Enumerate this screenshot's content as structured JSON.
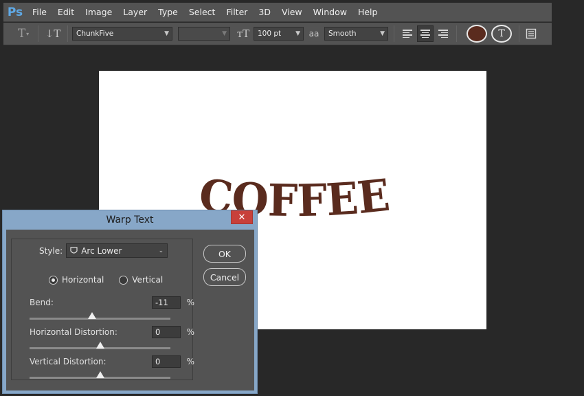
{
  "app": {
    "logo": "Ps"
  },
  "menu": [
    "File",
    "Edit",
    "Image",
    "Layer",
    "Type",
    "Select",
    "Filter",
    "3D",
    "View",
    "Window",
    "Help"
  ],
  "options": {
    "font_family": "ChunkFive",
    "font_style": "",
    "font_size": "100 pt",
    "antialias_icon_text": "aa",
    "antialias": "Smooth",
    "text_color": "#5a2b1e"
  },
  "canvas": {
    "text": "COFFEE",
    "text_color": "#5a2b1e"
  },
  "dialog": {
    "title": "Warp Text",
    "close_label": "✕",
    "style_label": "Style:",
    "style_value": "Arc Lower",
    "radio_horizontal": "Horizontal",
    "radio_vertical": "Vertical",
    "orientation_selected": "horizontal",
    "bend_label": "Bend:",
    "bend_value": "-11",
    "hdist_label": "Horizontal Distortion:",
    "hdist_value": "0",
    "vdist_label": "Vertical Distortion:",
    "vdist_value": "0",
    "pct": "%",
    "ok_label": "OK",
    "cancel_label": "Cancel"
  }
}
